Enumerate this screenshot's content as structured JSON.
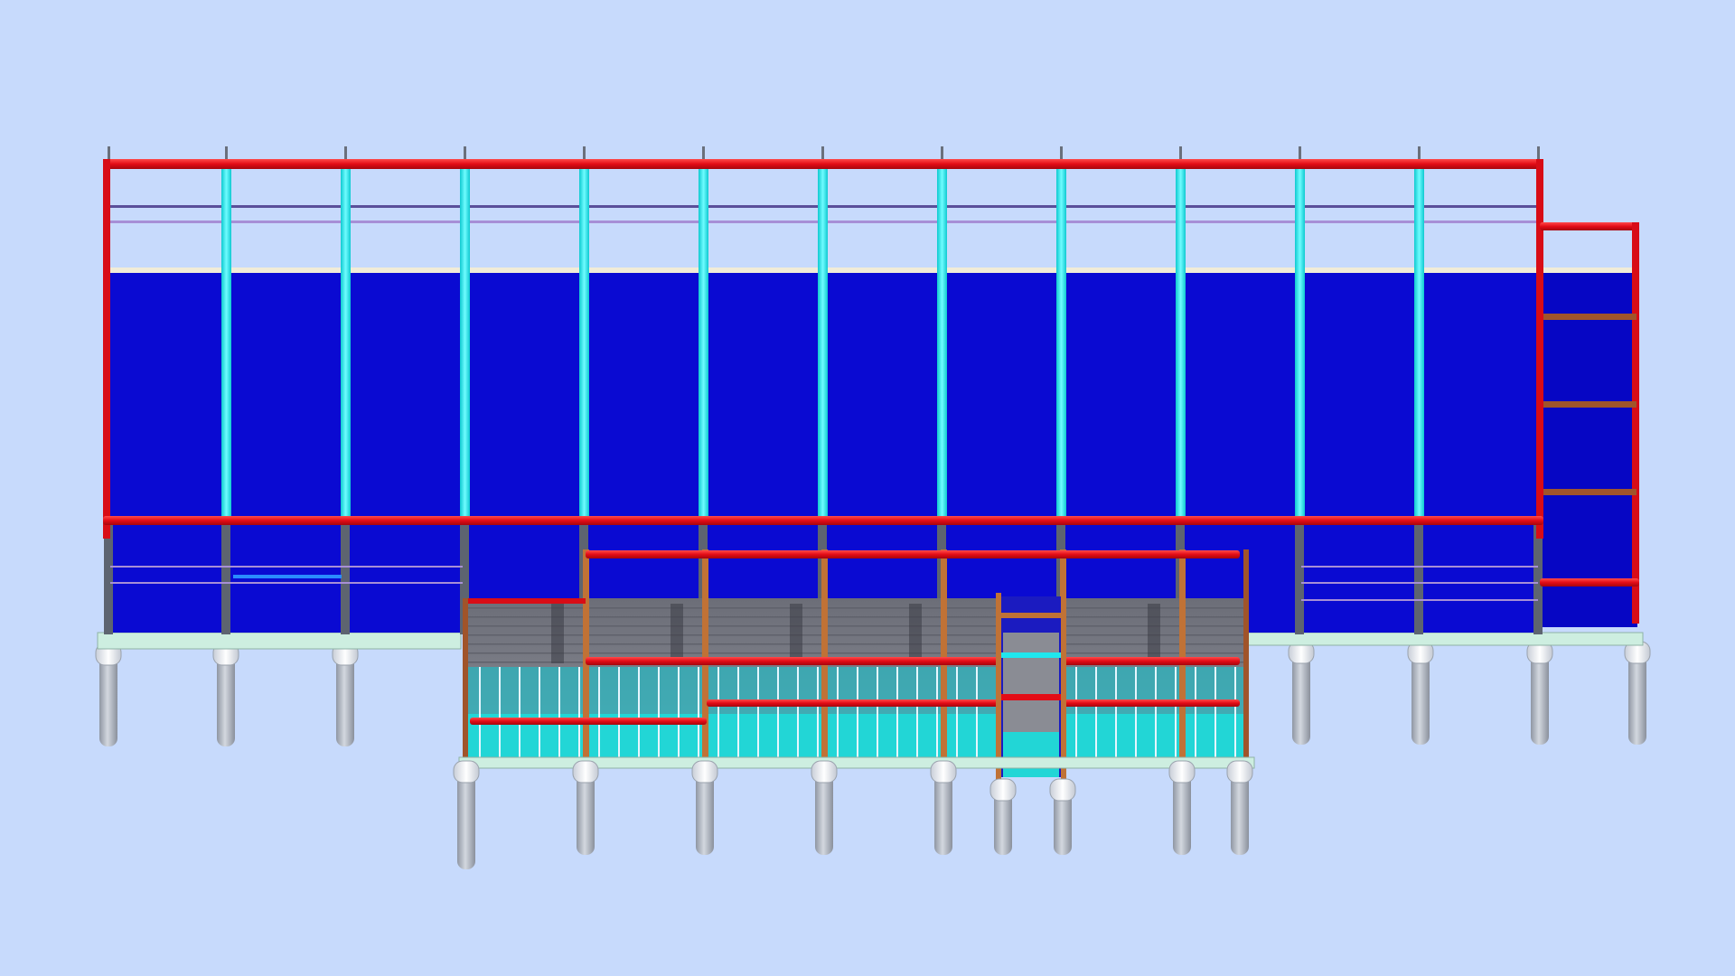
{
  "scene": {
    "view": "front-elevation",
    "model": "structural-building-frame",
    "colors": {
      "background": "#c7dafc",
      "wall_panel": "#0a0ad2",
      "wall_panel_light": "#1a1ae6",
      "primary_beam": "#e8101a",
      "cyan_column": "#12ecf2",
      "steel_column": "#5d6470",
      "timber_column": "#c07236",
      "railing": "#a78fd6",
      "railing_dark": "#5a4f9a",
      "deck_floor": "#7b7d86",
      "glazing": "#22d6d6",
      "plinth": "#cdeee0",
      "pile": "#b6bcc6",
      "pile_cap": "#e9edf2"
    },
    "components": [
      "back-wall",
      "top-ring-beam",
      "mid-floor-beam",
      "cyan-columns",
      "steel-columns",
      "timber-frame",
      "balcony-railings",
      "stair-tower",
      "side-annex",
      "foundation-piles"
    ]
  }
}
